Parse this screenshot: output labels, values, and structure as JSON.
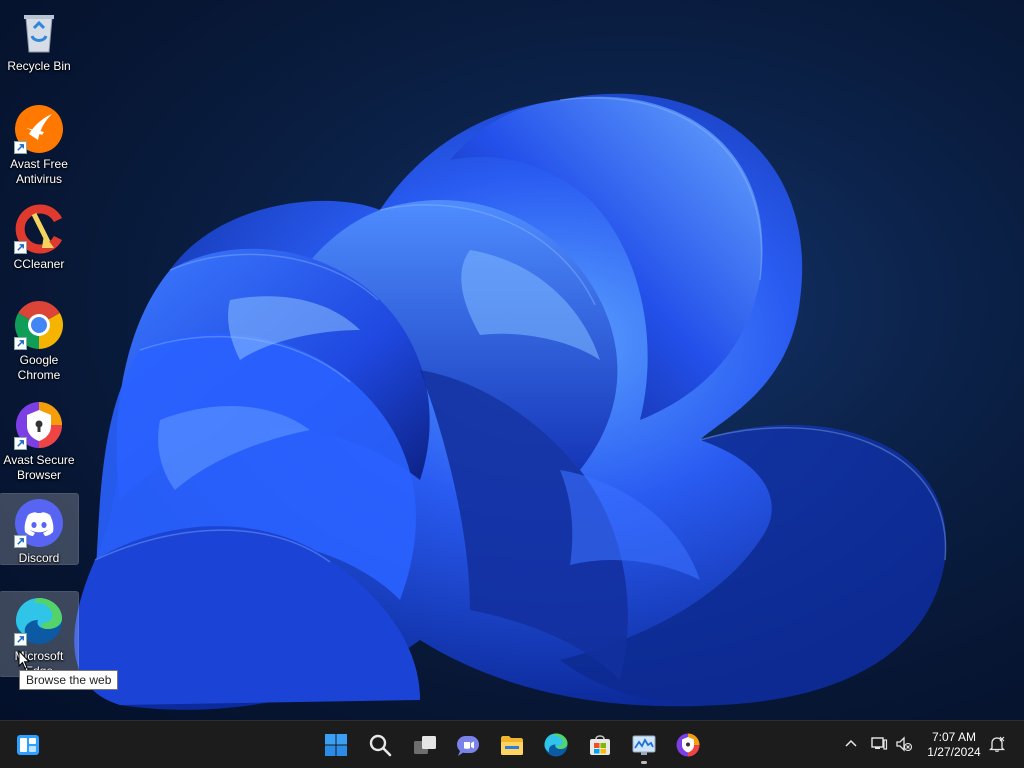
{
  "desktop": {
    "icons": [
      {
        "label": "Recycle Bin",
        "icon": "recycle-bin-icon"
      },
      {
        "label": "Avast Free\nAntivirus",
        "icon": "avast-antivirus-icon"
      },
      {
        "label": "CCleaner",
        "icon": "ccleaner-icon"
      },
      {
        "label": "Google\nChrome",
        "icon": "chrome-icon"
      },
      {
        "label": "Avast Secure\nBrowser",
        "icon": "avast-browser-icon"
      },
      {
        "label": "Discord",
        "icon": "discord-icon"
      },
      {
        "label": "Microsoft\nEdge",
        "icon": "edge-icon"
      }
    ],
    "tooltip": "Browse the web"
  },
  "taskbar": {
    "items": [
      {
        "name": "widgets",
        "icon": "widgets-icon"
      },
      {
        "name": "start",
        "icon": "windows-start-icon"
      },
      {
        "name": "search",
        "icon": "search-icon"
      },
      {
        "name": "task-view",
        "icon": "task-view-icon"
      },
      {
        "name": "chat",
        "icon": "chat-icon"
      },
      {
        "name": "file-explorer",
        "icon": "folder-icon"
      },
      {
        "name": "edge",
        "icon": "edge-icon"
      },
      {
        "name": "store",
        "icon": "store-icon"
      },
      {
        "name": "task-manager",
        "icon": "monitor-chart-icon"
      },
      {
        "name": "avast-secure-browser",
        "icon": "avast-browser-icon"
      }
    ],
    "tray": {
      "icons": [
        "chevron-up-icon",
        "network-icon",
        "volume-muted-icon",
        "notification-icon"
      ],
      "time": "7:07 AM",
      "date": "1/27/2024"
    }
  },
  "colors": {
    "accent": "#1f5fff",
    "taskbar": "#1c1c1c",
    "wallpaper_bg": "#071633"
  }
}
